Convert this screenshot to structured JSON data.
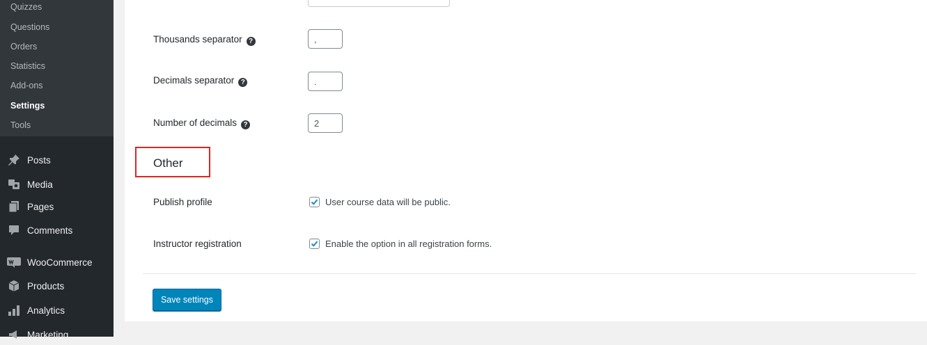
{
  "sidebar": {
    "submenu": [
      "Quizzes",
      "Questions",
      "Orders",
      "Statistics",
      "Add-ons",
      "Settings",
      "Tools"
    ],
    "current_submenu": "Settings",
    "menu": [
      {
        "label": "Posts",
        "icon": "pin-icon"
      },
      {
        "label": "Media",
        "icon": "media-icon"
      },
      {
        "label": "Pages",
        "icon": "pages-icon"
      },
      {
        "label": "Comments",
        "icon": "comments-icon"
      },
      {
        "label": "WooCommerce",
        "icon": "woocommerce-icon"
      },
      {
        "label": "Products",
        "icon": "products-icon"
      },
      {
        "label": "Analytics",
        "icon": "analytics-icon"
      },
      {
        "label": "Marketing",
        "icon": "marketing-icon"
      }
    ]
  },
  "settings": {
    "thousands_separator": {
      "label": "Thousands separator",
      "value": ","
    },
    "decimals_separator": {
      "label": "Decimals separator",
      "value": "."
    },
    "number_of_decimals": {
      "label": "Number of decimals",
      "value": "2"
    },
    "other_section_title": "Other",
    "publish_profile": {
      "label": "Publish profile",
      "checkbox_text": "User course data will be public.",
      "checked": true
    },
    "instructor_registration": {
      "label": "Instructor registration",
      "checkbox_text": "Enable the option in all registration forms.",
      "checked": true
    },
    "save_button": "Save settings"
  },
  "colors": {
    "sidebar_bg": "#23282d",
    "submenu_bg": "#32373c",
    "primary_button": "#0085ba",
    "highlight_border": "#e02424",
    "checkmark": "#1e8cbe"
  }
}
